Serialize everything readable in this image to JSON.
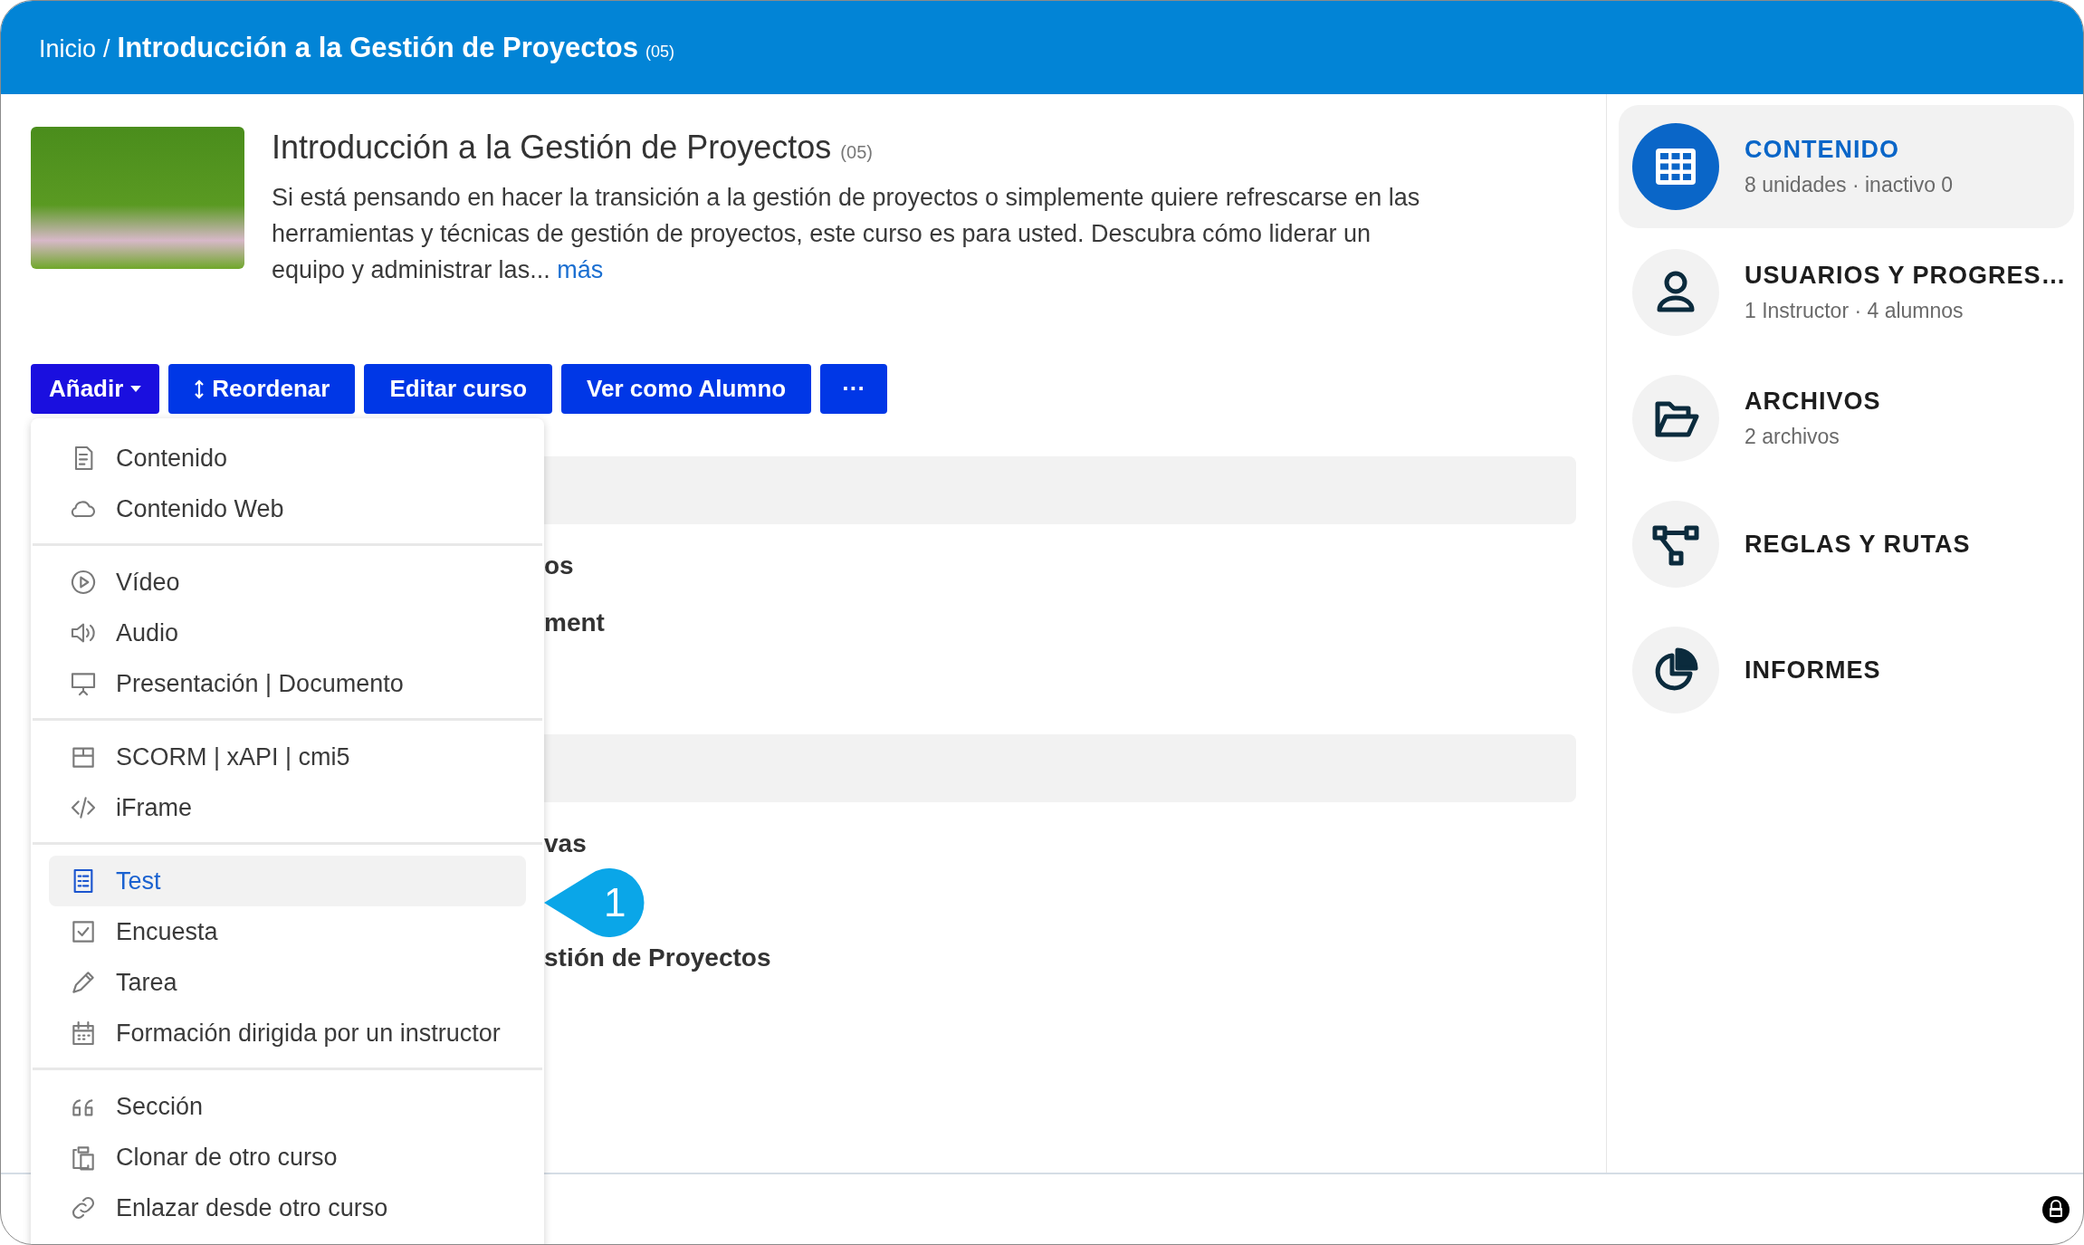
{
  "breadcrumb": {
    "home": "Inicio",
    "separator": "/",
    "current": "Introducción a la Gestión de Proyectos",
    "code": "(05)"
  },
  "course": {
    "title": "Introducción a la Gestión de Proyectos",
    "code": "(05)",
    "description": "Si está pensando en hacer la transición a la gestión de proyectos o simplemente quiere refrescarse en las herramientas y técnicas de gestión de proyectos, este curso es para usted. Descubra cómo liderar un equipo y administrar las...",
    "more_link": "más"
  },
  "actions": [
    {
      "label": "Añadir",
      "kind": "dropdown"
    },
    {
      "label": "Reordenar",
      "kind": "reorder"
    },
    {
      "label": "Editar curso",
      "kind": "plain"
    },
    {
      "label": "Ver como Alumno",
      "kind": "plain"
    },
    {
      "label": "···",
      "kind": "more"
    }
  ],
  "add_menu": {
    "groups": [
      [
        {
          "label": "Contenido",
          "selected": false
        },
        {
          "label": "Contenido Web",
          "selected": false
        }
      ],
      [
        {
          "label": "Vídeo",
          "selected": false
        },
        {
          "label": "Audio",
          "selected": false
        },
        {
          "label": "Presentación | Documento",
          "selected": false
        }
      ],
      [
        {
          "label": "SCORM | xAPI | cmi5",
          "selected": false
        },
        {
          "label": "iFrame",
          "selected": false
        }
      ],
      [
        {
          "label": "Test",
          "selected": true
        },
        {
          "label": "Encuesta",
          "selected": false
        },
        {
          "label": "Tarea",
          "selected": false
        },
        {
          "label": "Formación dirigida por un instructor",
          "selected": false
        }
      ],
      [
        {
          "label": "Sección",
          "selected": false
        },
        {
          "label": "Clonar de otro curso",
          "selected": false
        },
        {
          "label": "Enlazar desde otro curso",
          "selected": false
        }
      ]
    ]
  },
  "callout": {
    "label": "1"
  },
  "sections": [
    {
      "rows": [
        "os",
        "ment"
      ]
    },
    {
      "rows": [
        "vas",
        "stión de Proyectos"
      ]
    }
  ],
  "sidebar": {
    "items": [
      {
        "title": "CONTENIDO",
        "subtitle": "8 unidades · inactivo 0",
        "selected": true
      },
      {
        "title": "USUARIOS Y PROGRES…",
        "subtitle": "1 Instructor · 4 alumnos",
        "selected": false
      },
      {
        "title": "ARCHIVOS",
        "subtitle": "2 archivos",
        "selected": false
      },
      {
        "title": "REGLAS Y RUTAS",
        "selected": false
      },
      {
        "title": "INFORMES",
        "selected": false
      }
    ]
  }
}
